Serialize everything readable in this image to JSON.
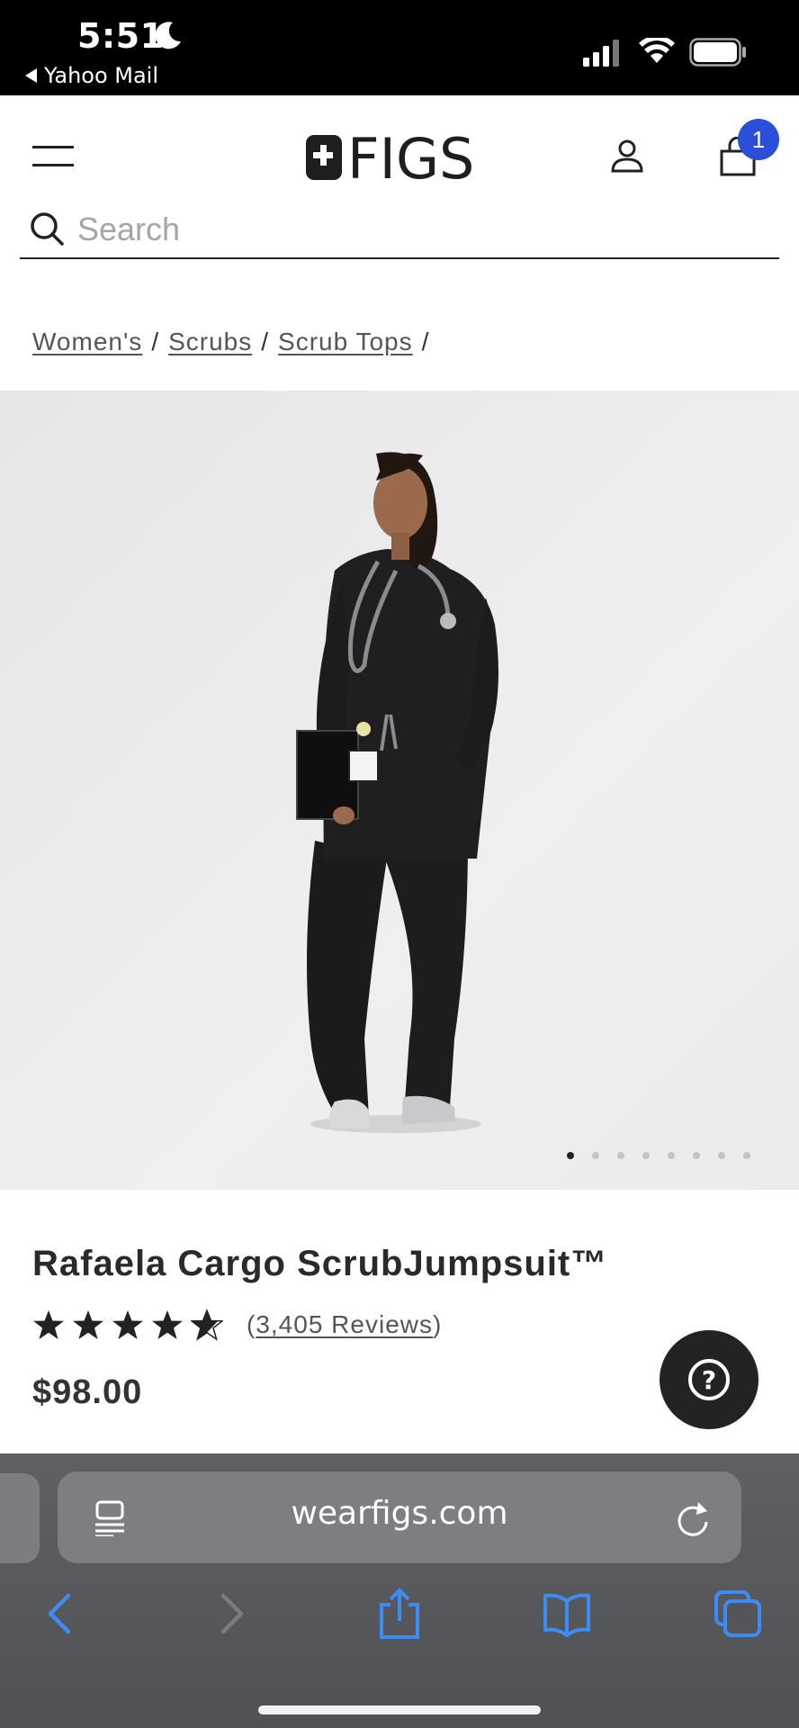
{
  "status_bar": {
    "time": "5:51",
    "back_app": "Yahoo Mail",
    "icons": [
      "moon-icon",
      "signal-icon",
      "wifi-icon",
      "battery-icon"
    ]
  },
  "header": {
    "logo_text": "FIGS",
    "cart_count": "1",
    "icons": [
      "menu-icon",
      "account-icon",
      "cart-icon"
    ],
    "badge_color": "#2b4fd8"
  },
  "search": {
    "placeholder": "Search",
    "value": ""
  },
  "breadcrumb": {
    "items": [
      "Women's",
      "Scrubs",
      "Scrub Tops"
    ],
    "separator": "/"
  },
  "product": {
    "title": "Rafaela Cargo ScrubJumpsuit™",
    "rating": 4.5,
    "rating_max": 5,
    "reviews_open": "(",
    "reviews_label": "3,405 Reviews",
    "reviews_close": ")",
    "price": "$98.00",
    "image_count": 8,
    "active_image": 1
  },
  "help_button": {
    "label": "?"
  },
  "browser": {
    "url": "wearfigs.com",
    "toolbar": [
      "back-icon",
      "forward-icon",
      "share-icon",
      "bookmarks-icon",
      "tabs-icon"
    ],
    "accent": "#3b8cf5"
  }
}
